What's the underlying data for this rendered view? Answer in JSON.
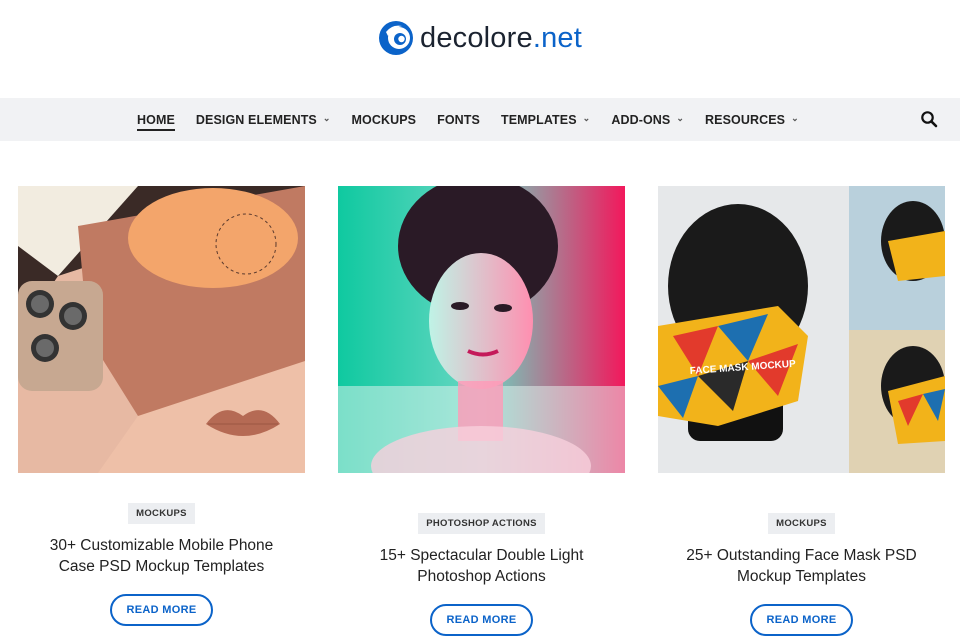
{
  "brand": {
    "name": "decolore",
    "tld": ".net",
    "accent": "#0b63c9"
  },
  "nav": {
    "items": [
      {
        "label": "HOME",
        "has_dropdown": false,
        "active": true
      },
      {
        "label": "DESIGN ELEMENTS",
        "has_dropdown": true,
        "active": false
      },
      {
        "label": "MOCKUPS",
        "has_dropdown": false,
        "active": false
      },
      {
        "label": "FONTS",
        "has_dropdown": false,
        "active": false
      },
      {
        "label": "TEMPLATES",
        "has_dropdown": true,
        "active": false
      },
      {
        "label": "ADD-ONS",
        "has_dropdown": true,
        "active": false
      },
      {
        "label": "RESOURCES",
        "has_dropdown": true,
        "active": false
      }
    ],
    "search_icon": "search-icon"
  },
  "posts": [
    {
      "tag": "MOCKUPS",
      "title": "30+ Customizable Mobile Phone Case PSD Mockup Templates",
      "cta": "READ MORE",
      "image": "phone-case-mockup-image"
    },
    {
      "tag": "PHOTOSHOP ACTIONS",
      "title": "15+ Spectacular Double Light Photoshop Actions",
      "cta": "READ MORE",
      "image": "double-light-portrait-image"
    },
    {
      "tag": "MOCKUPS",
      "title": "25+ Outstanding Face Mask PSD Mockup Templates",
      "cta": "READ MORE",
      "image": "face-mask-mockup-image",
      "image_text": "FACE MASK MOCKUP"
    }
  ]
}
